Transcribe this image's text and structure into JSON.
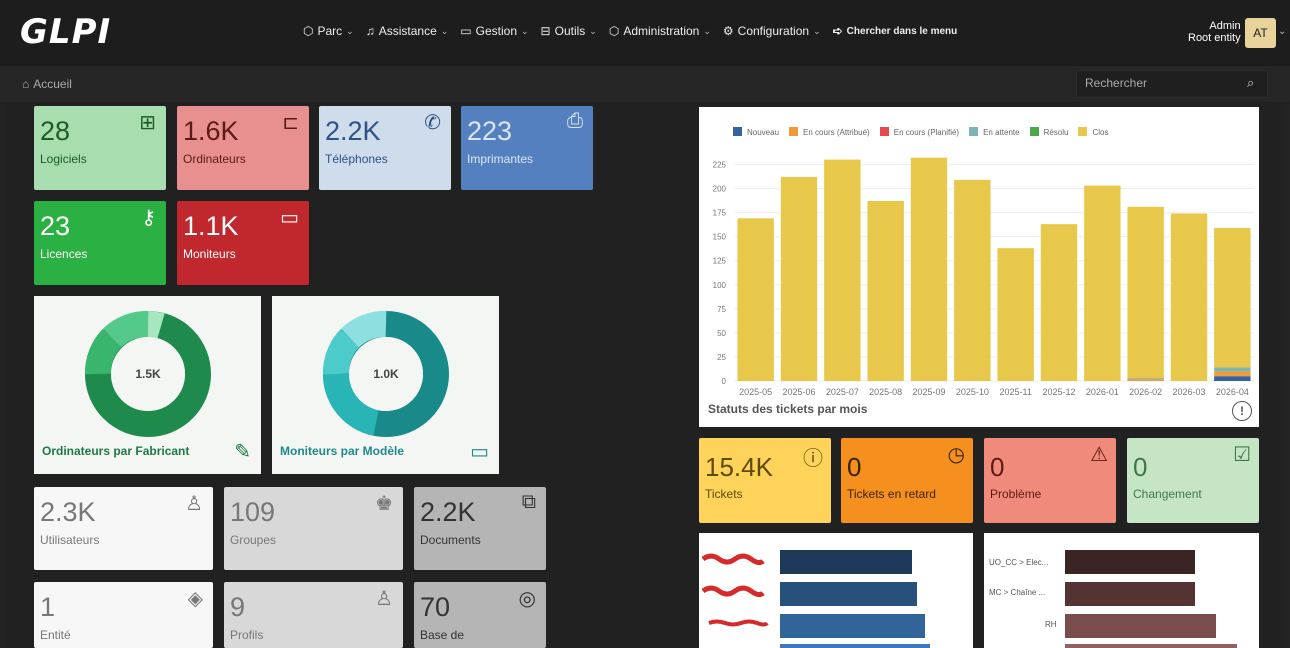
{
  "header": {
    "logo": "GLPI",
    "menu": [
      {
        "icon": "⬡",
        "label": "Parc"
      },
      {
        "icon": "♫",
        "label": "Assistance"
      },
      {
        "icon": "▭",
        "label": "Gestion"
      },
      {
        "icon": "⊟",
        "label": "Outils"
      },
      {
        "icon": "⬡",
        "label": "Administration"
      },
      {
        "icon": "⚙",
        "label": "Configuration"
      }
    ],
    "menu_search": "Chercher dans le menu",
    "user_name": "Admin",
    "user_entity": "Root entity",
    "avatar": "AT"
  },
  "subbar": {
    "breadcrumb": "Accueil",
    "search_placeholder": "Rechercher"
  },
  "cards": {
    "logiciels": {
      "value": "28",
      "label": "Logiciels"
    },
    "ordinateurs": {
      "value": "1.6K",
      "label": "Ordinateurs"
    },
    "telephones": {
      "value": "2.2K",
      "label": "Téléphones"
    },
    "imprimantes": {
      "value": "223",
      "label": "Imprimantes"
    },
    "licences": {
      "value": "23",
      "label": "Licences"
    },
    "moniteurs": {
      "value": "1.1K",
      "label": "Moniteurs"
    },
    "utilisateurs": {
      "value": "2.3K",
      "label": "Utilisateurs"
    },
    "groupes": {
      "value": "109",
      "label": "Groupes"
    },
    "documents": {
      "value": "2.2K",
      "label": "Documents"
    },
    "entite": {
      "value": "1",
      "label": "Entité"
    },
    "profils": {
      "value": "9",
      "label": "Profils"
    },
    "base": {
      "value": "70",
      "label": "Base de"
    }
  },
  "donuts": {
    "ordinateurs": {
      "center": "1.5K",
      "title": "Ordinateurs par Fabricant"
    },
    "moniteurs": {
      "center": "1.0K",
      "title": "Moniteurs par Modèle"
    }
  },
  "stats": {
    "tickets": {
      "value": "15.4K",
      "label": "Tickets"
    },
    "retard": {
      "value": "0",
      "label": "Tickets en retard"
    },
    "probleme": {
      "value": "0",
      "label": "Problème"
    },
    "changement": {
      "value": "0",
      "label": "Changement"
    }
  },
  "chart_data": {
    "type": "bar",
    "title": "Statuts des tickets par mois",
    "categories": [
      "2025-05",
      "2025-06",
      "2025-07",
      "2025-08",
      "2025-09",
      "2025-10",
      "2025-11",
      "2025-12",
      "2026-01",
      "2026-02",
      "2026-03",
      "2026-04"
    ],
    "yticks": [
      0,
      25,
      50,
      75,
      100,
      125,
      150,
      175,
      200,
      225
    ],
    "ylim": [
      0,
      240
    ],
    "series": [
      {
        "name": "Nouveau",
        "color": "#36629e",
        "values": [
          0,
          0,
          0,
          0,
          0,
          0,
          0,
          0,
          0,
          0,
          0,
          5
        ]
      },
      {
        "name": "En cours (Attribué)",
        "color": "#f09a38",
        "values": [
          0,
          0,
          0,
          0,
          0,
          0,
          0,
          0,
          0,
          2,
          0,
          5
        ]
      },
      {
        "name": "En cours (Planifié)",
        "color": "#e5484d",
        "values": [
          0,
          0,
          0,
          0,
          0,
          0,
          0,
          0,
          0,
          0,
          0,
          0
        ]
      },
      {
        "name": "En attente",
        "color": "#7fb3b3",
        "values": [
          0,
          0,
          0,
          0,
          0,
          0,
          0,
          0,
          0,
          1,
          0,
          4
        ]
      },
      {
        "name": "Résolu",
        "color": "#4ca64c",
        "values": [
          0,
          0,
          0,
          0,
          0,
          0,
          0,
          0,
          0,
          0,
          0,
          0
        ]
      },
      {
        "name": "Clos",
        "color": "#e8c84a",
        "values": [
          169,
          212,
          230,
          187,
          232,
          209,
          138,
          163,
          203,
          178,
          174,
          145
        ]
      }
    ]
  },
  "bottom_right": {
    "labels": [
      "UO_CC > Elec...",
      "MC > Chaîne ...",
      "RH"
    ]
  }
}
